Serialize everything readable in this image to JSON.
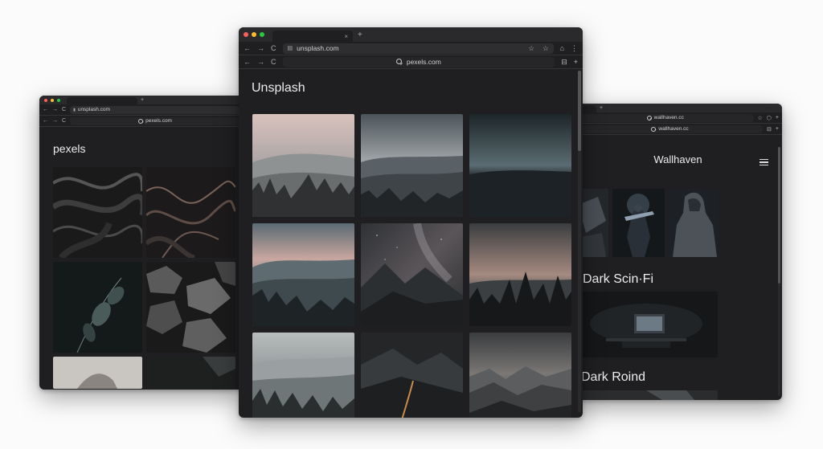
{
  "colors": {
    "page_bg": "#fbfbfb",
    "window_bg": "#1f1f21",
    "close_red": "#ff5f57",
    "min_yellow": "#febc2e",
    "max_green": "#28c840"
  },
  "main_window": {
    "tab_close": "×",
    "tab_new": "+",
    "nav": {
      "back": "←",
      "forward": "→",
      "reload": "C"
    },
    "url": "unsplash.com",
    "secondary_url": "pexels.com",
    "site_title": "Unsplash",
    "icons": [
      "star-icon",
      "star-outline-icon",
      "extension-icon",
      "menu-dots-icon"
    ],
    "photos": [
      {
        "alt": "misty-forest-dawn"
      },
      {
        "alt": "cloudy-mountain-ridges"
      },
      {
        "alt": "dark-horizon-glow"
      },
      {
        "alt": "foggy-valley-sunset"
      },
      {
        "alt": "milky-way-mountains"
      },
      {
        "alt": "pine-silhouettes-dusk"
      },
      {
        "alt": "foggy-forest-hills"
      },
      {
        "alt": "night-road-mountains"
      },
      {
        "alt": "layered-mountain-range"
      }
    ]
  },
  "left_window": {
    "tab_new": "+",
    "url": "unsplash.com",
    "secondary_url": "pexels.com",
    "site_title": "pexels",
    "nav": {
      "back": "←",
      "forward": "→",
      "reload": "C"
    },
    "photos": [
      {
        "alt": "dark-marble-swirl"
      },
      {
        "alt": "marble-waves-copper"
      },
      {
        "alt": "eucalyptus-leaves"
      },
      {
        "alt": "dark-rocks"
      },
      {
        "alt": "light-sculpture-partial"
      },
      {
        "alt": "dark-texture-partial"
      }
    ]
  },
  "right_window": {
    "tab_new": "+",
    "url": "wallhaven.cc",
    "secondary_url": "wallhaven.cc",
    "site_title": "Wallhaven",
    "section_1": "Dark Scin·Fi",
    "section_2": "Dark Roind",
    "photos": [
      {
        "alt": "scifi-partial"
      },
      {
        "alt": "armored-warrior"
      },
      {
        "alt": "hooded-soldier"
      }
    ]
  }
}
